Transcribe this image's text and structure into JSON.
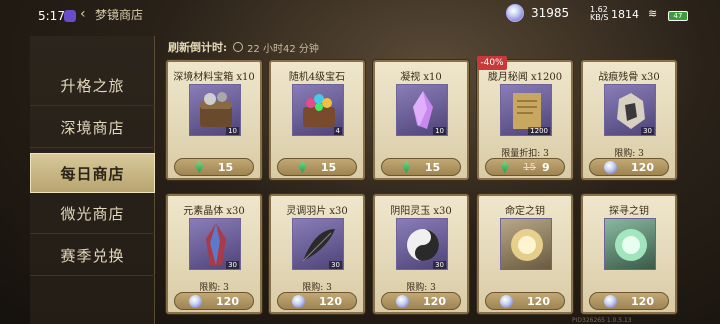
{
  "status": {
    "time": "5:17",
    "net_speed_top": "1.62",
    "net_speed_bottom": "KB/S",
    "clock_alt": "1814",
    "battery": "47"
  },
  "header": {
    "back": "‹",
    "title": "梦镜商店",
    "currency_value": "31985"
  },
  "sidebar": {
    "items": [
      {
        "label": "升格之旅"
      },
      {
        "label": "深境商店"
      },
      {
        "label": "每日商店",
        "active": true
      },
      {
        "label": "微光商店"
      },
      {
        "label": "赛季兑换"
      }
    ]
  },
  "refresh": {
    "label": "刷新倒计时:",
    "value": "22 小时42 分钟"
  },
  "cards": [
    {
      "title": "深境材料宝箱 x10",
      "qty": "10",
      "limit": "",
      "price": "15",
      "currency": "gem"
    },
    {
      "title": "随机4级宝石",
      "qty": "4",
      "limit": "",
      "price": "15",
      "currency": "gem"
    },
    {
      "title": "凝视 x10",
      "qty": "10",
      "limit": "",
      "price": "15",
      "currency": "gem"
    },
    {
      "title": "胧月秘闻 x1200",
      "qty": "1200",
      "limit": "限量折扣: 3",
      "price": "9",
      "old_price": "15",
      "sale": "-40%",
      "currency": "gem"
    },
    {
      "title": "战痕残骨 x30",
      "qty": "30",
      "limit": "限购: 3",
      "price": "120",
      "currency": "orb"
    },
    {
      "title": "元素晶体 x30",
      "qty": "30",
      "limit": "限购: 3",
      "price": "120",
      "currency": "orb"
    },
    {
      "title": "灵调羽片 x30",
      "qty": "30",
      "limit": "限购: 3",
      "price": "120",
      "currency": "orb"
    },
    {
      "title": "阴阳灵玉 x30",
      "qty": "30",
      "limit": "限购: 3",
      "price": "120",
      "currency": "orb"
    },
    {
      "title": "命定之钥",
      "qty": "",
      "limit": "",
      "price": "120",
      "currency": "orb"
    },
    {
      "title": "探寻之钥",
      "qty": "",
      "limit": "",
      "price": "120",
      "currency": "orb"
    }
  ],
  "footer": {
    "version": "PID326265 1.0.5.13"
  },
  "colors": {
    "sale_red": "#c83a3a",
    "active_tab": "#d8c89a",
    "card_bg": "#efe6cc"
  }
}
